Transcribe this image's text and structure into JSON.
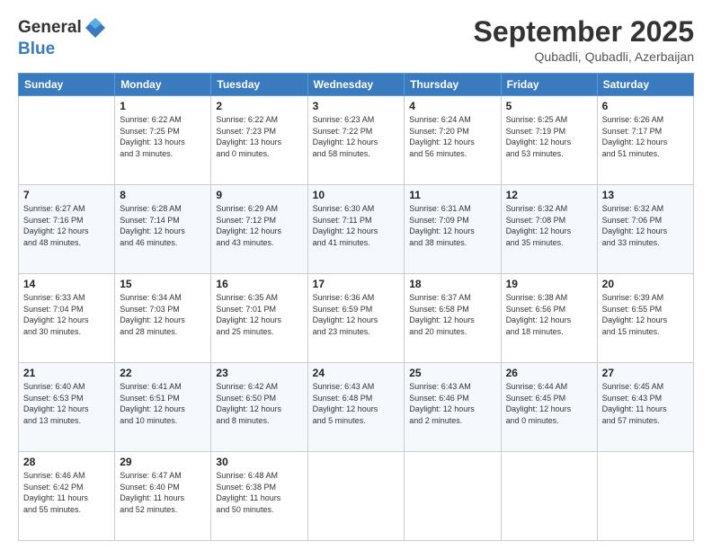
{
  "logo": {
    "line1": "General",
    "line2": "Blue"
  },
  "header": {
    "month": "September 2025",
    "location": "Qubadli, Qubadli, Azerbaijan"
  },
  "days": [
    "Sunday",
    "Monday",
    "Tuesday",
    "Wednesday",
    "Thursday",
    "Friday",
    "Saturday"
  ],
  "weeks": [
    [
      {
        "num": "",
        "info": ""
      },
      {
        "num": "1",
        "info": "Sunrise: 6:22 AM\nSunset: 7:25 PM\nDaylight: 13 hours\nand 3 minutes."
      },
      {
        "num": "2",
        "info": "Sunrise: 6:22 AM\nSunset: 7:23 PM\nDaylight: 13 hours\nand 0 minutes."
      },
      {
        "num": "3",
        "info": "Sunrise: 6:23 AM\nSunset: 7:22 PM\nDaylight: 12 hours\nand 58 minutes."
      },
      {
        "num": "4",
        "info": "Sunrise: 6:24 AM\nSunset: 7:20 PM\nDaylight: 12 hours\nand 56 minutes."
      },
      {
        "num": "5",
        "info": "Sunrise: 6:25 AM\nSunset: 7:19 PM\nDaylight: 12 hours\nand 53 minutes."
      },
      {
        "num": "6",
        "info": "Sunrise: 6:26 AM\nSunset: 7:17 PM\nDaylight: 12 hours\nand 51 minutes."
      }
    ],
    [
      {
        "num": "7",
        "info": "Sunrise: 6:27 AM\nSunset: 7:16 PM\nDaylight: 12 hours\nand 48 minutes."
      },
      {
        "num": "8",
        "info": "Sunrise: 6:28 AM\nSunset: 7:14 PM\nDaylight: 12 hours\nand 46 minutes."
      },
      {
        "num": "9",
        "info": "Sunrise: 6:29 AM\nSunset: 7:12 PM\nDaylight: 12 hours\nand 43 minutes."
      },
      {
        "num": "10",
        "info": "Sunrise: 6:30 AM\nSunset: 7:11 PM\nDaylight: 12 hours\nand 41 minutes."
      },
      {
        "num": "11",
        "info": "Sunrise: 6:31 AM\nSunset: 7:09 PM\nDaylight: 12 hours\nand 38 minutes."
      },
      {
        "num": "12",
        "info": "Sunrise: 6:32 AM\nSunset: 7:08 PM\nDaylight: 12 hours\nand 35 minutes."
      },
      {
        "num": "13",
        "info": "Sunrise: 6:32 AM\nSunset: 7:06 PM\nDaylight: 12 hours\nand 33 minutes."
      }
    ],
    [
      {
        "num": "14",
        "info": "Sunrise: 6:33 AM\nSunset: 7:04 PM\nDaylight: 12 hours\nand 30 minutes."
      },
      {
        "num": "15",
        "info": "Sunrise: 6:34 AM\nSunset: 7:03 PM\nDaylight: 12 hours\nand 28 minutes."
      },
      {
        "num": "16",
        "info": "Sunrise: 6:35 AM\nSunset: 7:01 PM\nDaylight: 12 hours\nand 25 minutes."
      },
      {
        "num": "17",
        "info": "Sunrise: 6:36 AM\nSunset: 6:59 PM\nDaylight: 12 hours\nand 23 minutes."
      },
      {
        "num": "18",
        "info": "Sunrise: 6:37 AM\nSunset: 6:58 PM\nDaylight: 12 hours\nand 20 minutes."
      },
      {
        "num": "19",
        "info": "Sunrise: 6:38 AM\nSunset: 6:56 PM\nDaylight: 12 hours\nand 18 minutes."
      },
      {
        "num": "20",
        "info": "Sunrise: 6:39 AM\nSunset: 6:55 PM\nDaylight: 12 hours\nand 15 minutes."
      }
    ],
    [
      {
        "num": "21",
        "info": "Sunrise: 6:40 AM\nSunset: 6:53 PM\nDaylight: 12 hours\nand 13 minutes."
      },
      {
        "num": "22",
        "info": "Sunrise: 6:41 AM\nSunset: 6:51 PM\nDaylight: 12 hours\nand 10 minutes."
      },
      {
        "num": "23",
        "info": "Sunrise: 6:42 AM\nSunset: 6:50 PM\nDaylight: 12 hours\nand 8 minutes."
      },
      {
        "num": "24",
        "info": "Sunrise: 6:43 AM\nSunset: 6:48 PM\nDaylight: 12 hours\nand 5 minutes."
      },
      {
        "num": "25",
        "info": "Sunrise: 6:43 AM\nSunset: 6:46 PM\nDaylight: 12 hours\nand 2 minutes."
      },
      {
        "num": "26",
        "info": "Sunrise: 6:44 AM\nSunset: 6:45 PM\nDaylight: 12 hours\nand 0 minutes."
      },
      {
        "num": "27",
        "info": "Sunrise: 6:45 AM\nSunset: 6:43 PM\nDaylight: 11 hours\nand 57 minutes."
      }
    ],
    [
      {
        "num": "28",
        "info": "Sunrise: 6:46 AM\nSunset: 6:42 PM\nDaylight: 11 hours\nand 55 minutes."
      },
      {
        "num": "29",
        "info": "Sunrise: 6:47 AM\nSunset: 6:40 PM\nDaylight: 11 hours\nand 52 minutes."
      },
      {
        "num": "30",
        "info": "Sunrise: 6:48 AM\nSunset: 6:38 PM\nDaylight: 11 hours\nand 50 minutes."
      },
      {
        "num": "",
        "info": ""
      },
      {
        "num": "",
        "info": ""
      },
      {
        "num": "",
        "info": ""
      },
      {
        "num": "",
        "info": ""
      }
    ]
  ]
}
